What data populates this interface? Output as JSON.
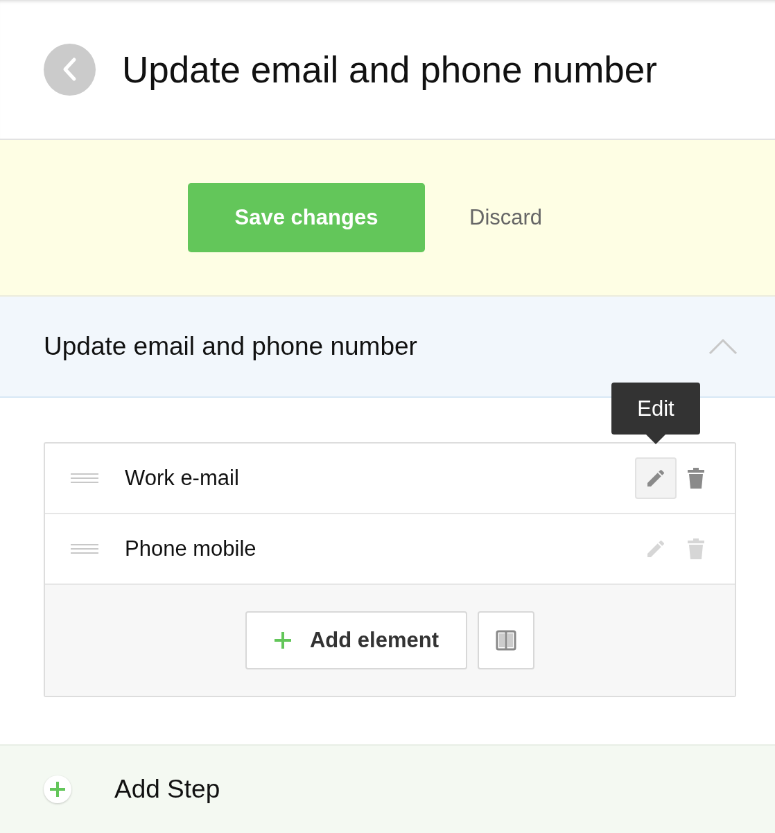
{
  "header": {
    "title": "Update email and phone number"
  },
  "actions": {
    "save": "Save changes",
    "discard": "Discard"
  },
  "section": {
    "title": "Update email and phone number",
    "expanded": true
  },
  "elements": [
    {
      "label": "Work e-mail",
      "active": true,
      "tooltip": "Edit"
    },
    {
      "label": "Phone mobile",
      "active": false
    }
  ],
  "add_element": "Add element",
  "add_step": "Add Step"
}
